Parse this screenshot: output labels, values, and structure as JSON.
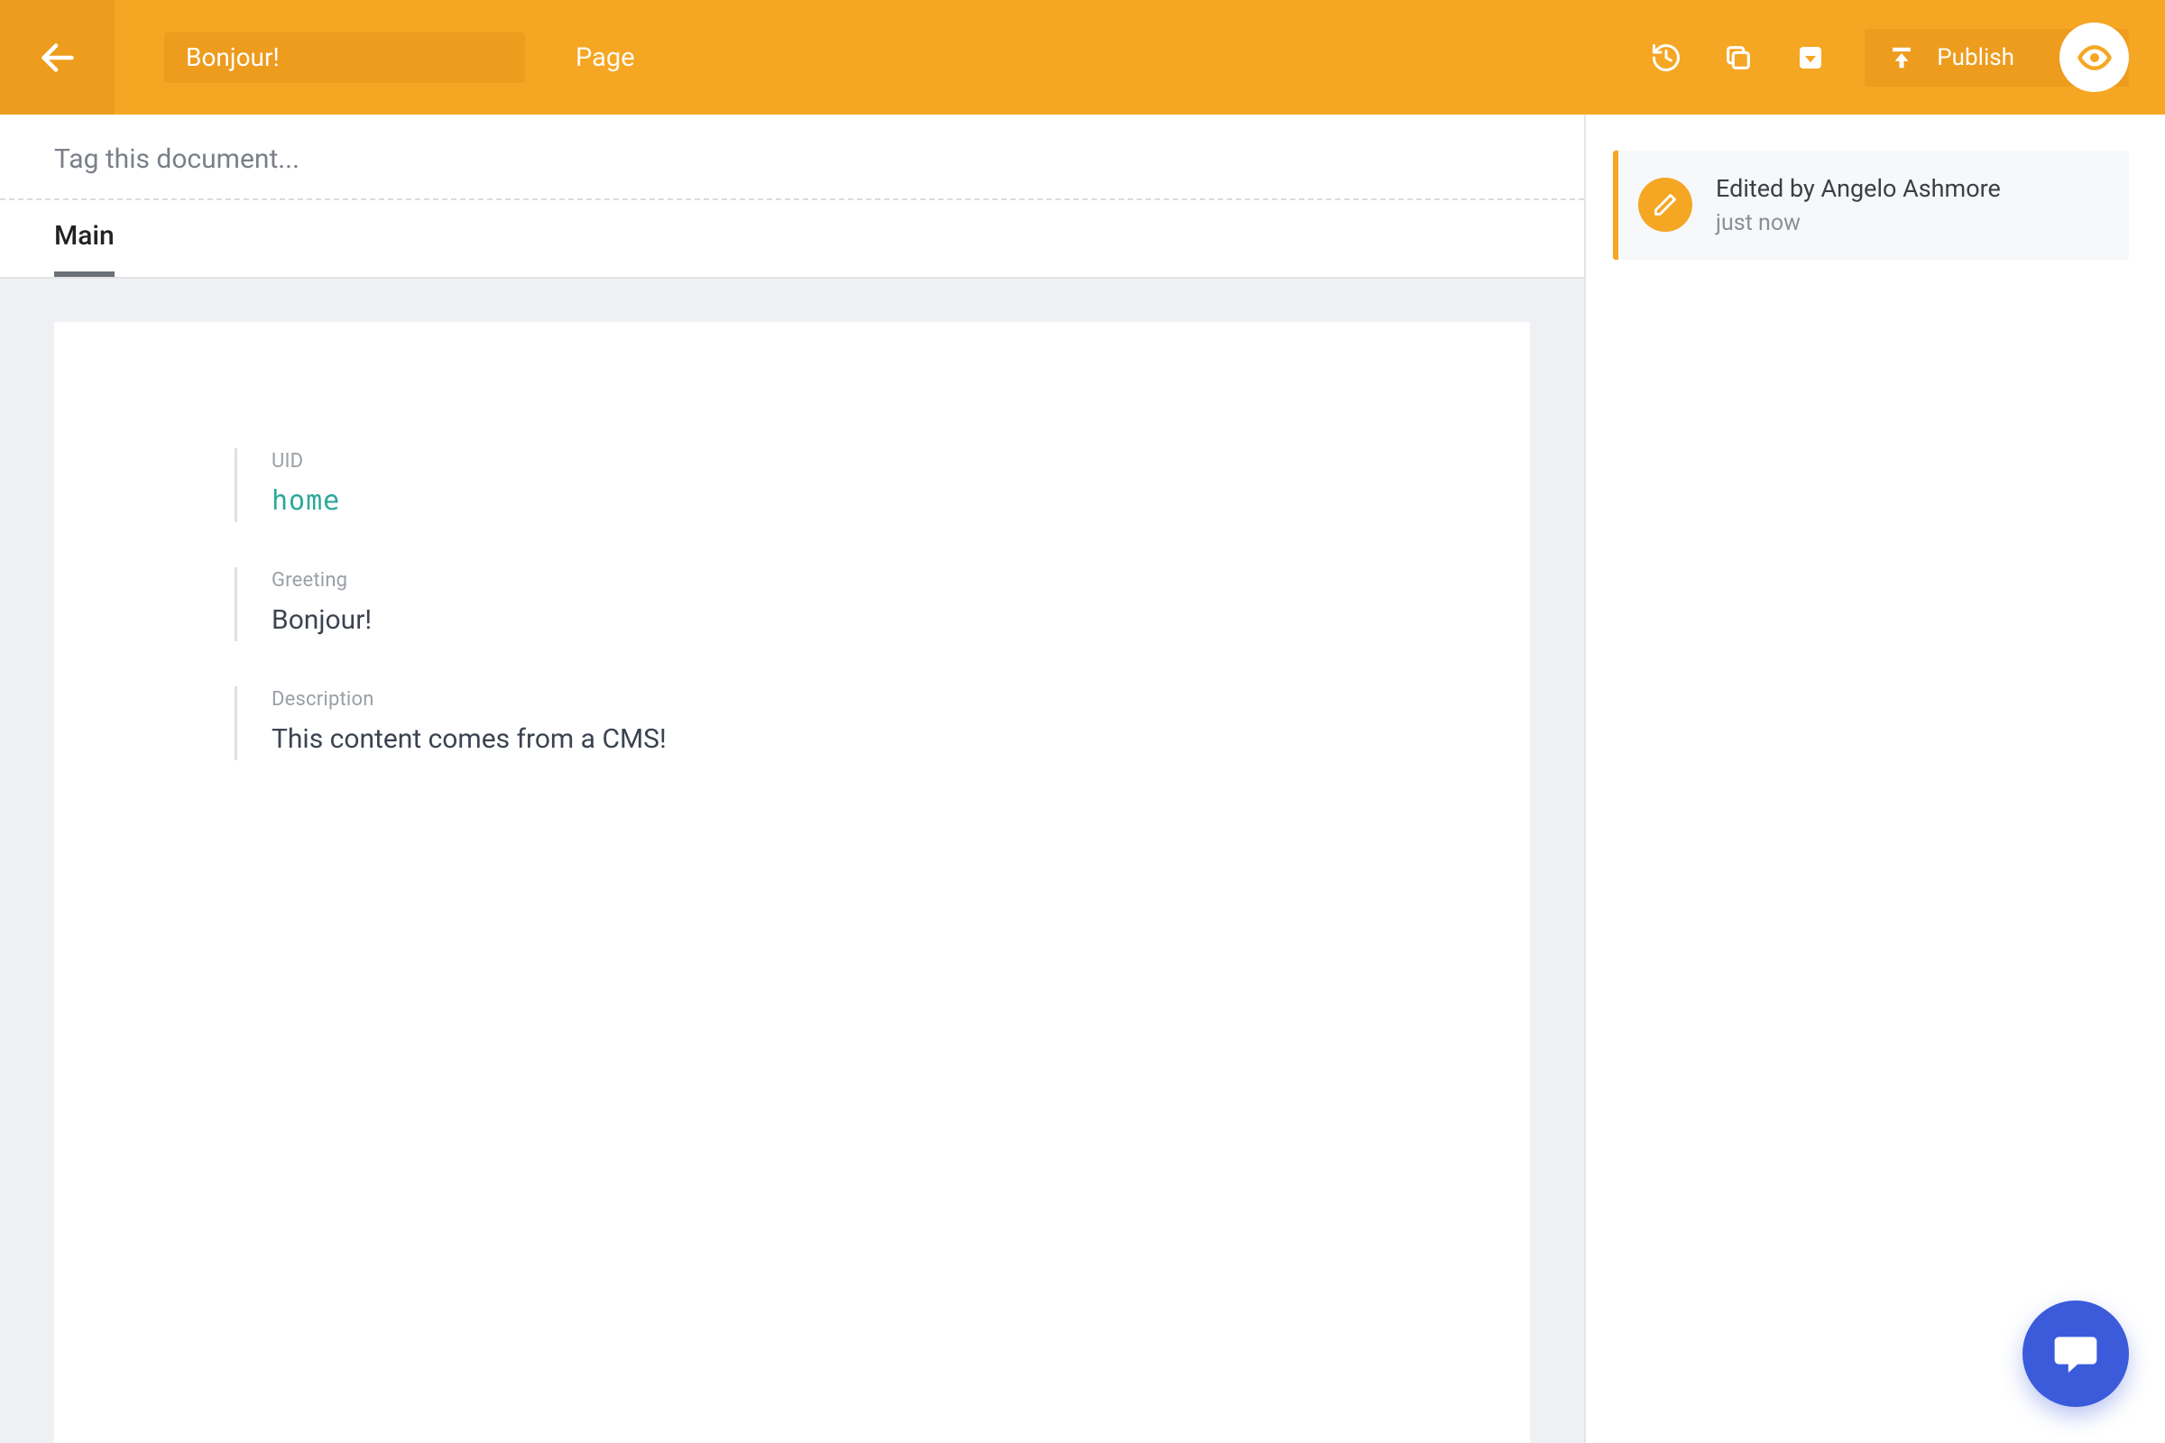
{
  "header": {
    "title": "Bonjour!",
    "doc_type": "Page",
    "publish_label": "Publish"
  },
  "tag_bar": {
    "placeholder": "Tag this document..."
  },
  "tabs": [
    {
      "label": "Main",
      "active": true
    }
  ],
  "fields": {
    "uid": {
      "label": "UID",
      "value": "home"
    },
    "greeting": {
      "label": "Greeting",
      "value": "Bonjour!"
    },
    "description": {
      "label": "Description",
      "value": "This content comes from a CMS!"
    }
  },
  "activity": {
    "title": "Edited by Angelo Ashmore",
    "time": "just now"
  },
  "colors": {
    "accent": "#F5A623",
    "accent_dark": "#ED9C1D",
    "chat": "#3b5bdb",
    "uid_color": "#2aa89a"
  }
}
